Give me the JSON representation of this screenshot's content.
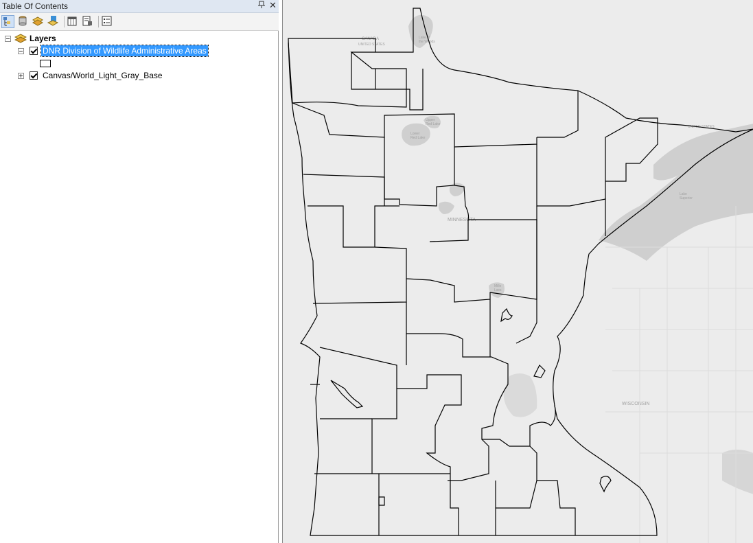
{
  "panel": {
    "title": "Table Of Contents",
    "pin_glyph": "ᵖ",
    "close_glyph": "✕"
  },
  "toolbar": {
    "buttons": [
      {
        "name": "list-by-drawing-order",
        "icon": "layers-drawing-order-icon"
      },
      {
        "name": "list-by-source",
        "icon": "database-icon"
      },
      {
        "name": "list-by-visibility",
        "icon": "visibility-layers-icon"
      },
      {
        "name": "list-by-selection",
        "icon": "selection-layers-icon"
      },
      {
        "name": "options",
        "icon": "options-icon"
      }
    ]
  },
  "tree": {
    "root_label": "Layers",
    "layers": [
      {
        "label": "DNR Division of Wildlife Administrative Areas",
        "checked": true,
        "expanded": true,
        "selected": true
      },
      {
        "label": "Canvas/World_Light_Gray_Base",
        "checked": true,
        "expanded": false,
        "selected": false
      }
    ]
  },
  "map": {
    "basemap_color": "#ececec",
    "water_color": "#cfcfcf",
    "boundary_color": "#000000",
    "labels": [
      {
        "text": "CANADA",
        "size": 6
      },
      {
        "text": "UNITED STATES",
        "size": 5
      },
      {
        "text": "Lake of\nthe Woods",
        "size": 5
      },
      {
        "text": "Lower\nRed Lake",
        "size": 5
      },
      {
        "text": "Upper\nRed Lake",
        "size": 5
      },
      {
        "text": "MINNESOTA",
        "size": 7
      },
      {
        "text": "Lake\nSuperior",
        "size": 5
      },
      {
        "text": "Mille\nLacs",
        "size": 5
      },
      {
        "text": "WISCONSIN",
        "size": 7
      },
      {
        "text": "UNITED STATES",
        "size": 5
      }
    ]
  }
}
